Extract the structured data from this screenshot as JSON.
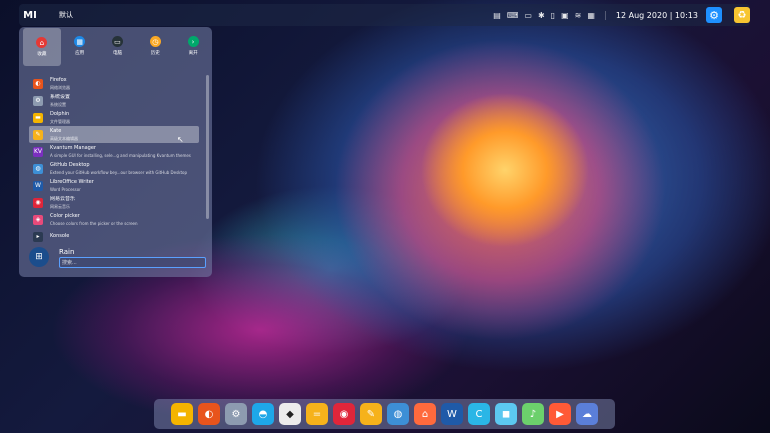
{
  "topbar": {
    "logo": "MI",
    "desktop_name": "默认",
    "tray_icons": [
      "clipboard-icon",
      "keyboard-icon",
      "battery-icon",
      "bluetooth-icon",
      "power-icon",
      "monitor-icon",
      "wifi-icon",
      "grid-icon"
    ],
    "tray_glyphs": [
      "▤",
      "⌨",
      "▭",
      "✱",
      "▯",
      "▣",
      "≋",
      "▦"
    ],
    "clock": "12 Aug 2020 | 10:13",
    "gear_glyph": "⚙",
    "bin_glyph": "♻"
  },
  "launcher": {
    "categories": [
      {
        "label": "收藏",
        "glyph": "⌂",
        "color": "#e53935",
        "active": true
      },
      {
        "label": "应用",
        "glyph": "▦",
        "color": "#1e88e5",
        "active": false
      },
      {
        "label": "电脑",
        "glyph": "▭",
        "color": "#263238",
        "active": false
      },
      {
        "label": "历史",
        "glyph": "◷",
        "color": "#f9a825",
        "active": false
      },
      {
        "label": "离开",
        "glyph": "›",
        "color": "#00a86b",
        "active": false
      }
    ],
    "apps": [
      {
        "name": "Firefox",
        "desc": "网络浏览器",
        "glyph": "◐",
        "color": "#e8541c"
      },
      {
        "name": "系统设置",
        "desc": "系统设置",
        "glyph": "⚙",
        "color": "#8d9bb0"
      },
      {
        "name": "Dolphin",
        "desc": "文件管理器",
        "glyph": "▬",
        "color": "#f4b400"
      },
      {
        "name": "Kate",
        "desc": "高级文本编辑器",
        "glyph": "✎",
        "color": "#f6b21b"
      },
      {
        "name": "Kvantum Manager",
        "desc": "A simple GUI for installing, sele...g and manipulating Kvantum themes",
        "glyph": "KV",
        "color": "#7b2fbf"
      },
      {
        "name": "GitHub Desktop",
        "desc": "Extend your GitHub workflow bey...our browser with GitHub Desktop",
        "glyph": "◍",
        "color": "#3d8fd6"
      },
      {
        "name": "LibreOffice Writer",
        "desc": "Word Processor",
        "glyph": "W",
        "color": "#1f5aa8"
      },
      {
        "name": "网易云音乐",
        "desc": "网易云音乐",
        "glyph": "◉",
        "color": "#e0263a"
      },
      {
        "name": "Color picker",
        "desc": "Choose colors from the picker or the screen",
        "glyph": "◈",
        "color": "#e94a7a"
      },
      {
        "name": "Konsole",
        "desc": "",
        "glyph": "▸",
        "color": "#2b3a52"
      }
    ],
    "user_name": "Rain",
    "avatar_glyph": "⊞",
    "search_placeholder": "搜索..."
  },
  "dock": [
    {
      "name": "files-icon",
      "glyph": "▬",
      "color": "#f4b400"
    },
    {
      "name": "firefox-icon",
      "glyph": "◐",
      "color": "#e8541c"
    },
    {
      "name": "settings-icon",
      "glyph": "⚙",
      "color": "#8d9bb0"
    },
    {
      "name": "qq-icon",
      "glyph": "◓",
      "color": "#1ea7e8"
    },
    {
      "name": "inkscape-icon",
      "glyph": "◆",
      "color": "#ececec"
    },
    {
      "name": "calculator-icon",
      "glyph": "=",
      "color": "#f6b21b"
    },
    {
      "name": "netease-music-icon",
      "glyph": "◉",
      "color": "#e0263a"
    },
    {
      "name": "kate-icon",
      "glyph": "✎",
      "color": "#f6b21b"
    },
    {
      "name": "github-icon",
      "glyph": "◍",
      "color": "#3d8fd6"
    },
    {
      "name": "shop-icon",
      "glyph": "⌂",
      "color": "#ff6a3d"
    },
    {
      "name": "writer-icon",
      "glyph": "W",
      "color": "#1f5aa8"
    },
    {
      "name": "app-c-icon",
      "glyph": "C",
      "color": "#2ab6e6"
    },
    {
      "name": "app-bubble-icon",
      "glyph": "◼",
      "color": "#5cc8f0"
    },
    {
      "name": "music-icon",
      "glyph": "♪",
      "color": "#6cd06c"
    },
    {
      "name": "video-icon",
      "glyph": "▶",
      "color": "#ff5a36"
    },
    {
      "name": "weather-icon",
      "glyph": "☁",
      "color": "#5b7fd9"
    }
  ]
}
